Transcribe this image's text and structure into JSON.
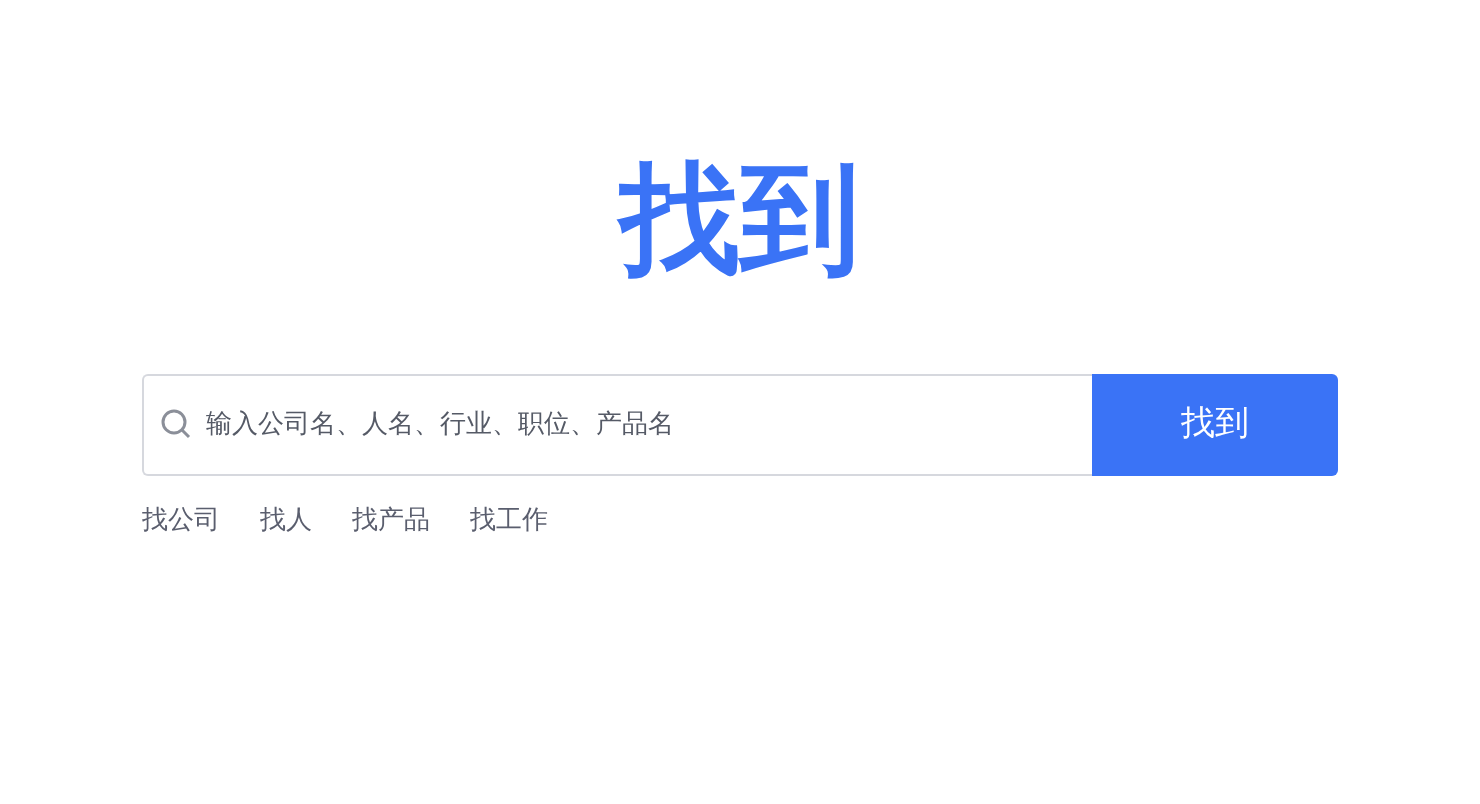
{
  "logo": "找到",
  "search": {
    "placeholder": "输入公司名、人名、行业、职位、产品名",
    "button": "找到"
  },
  "quick_links": [
    "找公司",
    "找人",
    "找产品",
    "找工作"
  ]
}
